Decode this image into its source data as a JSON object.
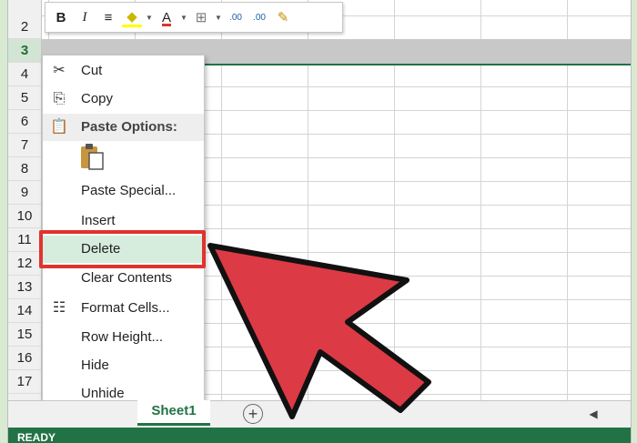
{
  "rows": [
    "2",
    "3",
    "4",
    "5",
    "6",
    "7",
    "8",
    "9",
    "10",
    "11",
    "12",
    "13",
    "14",
    "15",
    "16",
    "17"
  ],
  "selected_row": "3",
  "toolbar": {
    "bold": "B",
    "italic": "I",
    "align": "≡",
    "fill": "◆",
    "font_color": "A",
    "borders": "⊞",
    "increase_decimal": ".00",
    "decrease_decimal": ".00",
    "format_painter": "✎"
  },
  "menu": {
    "cut": "Cut",
    "copy": "Copy",
    "paste_options": "Paste Options:",
    "paste_special": "Paste Special...",
    "insert": "Insert",
    "delete": "Delete",
    "clear_contents": "Clear Contents",
    "format_cells": "Format Cells...",
    "row_height": "Row Height...",
    "hide": "Hide",
    "unhide": "Unhide"
  },
  "sheet": {
    "tab_label": "Sheet1",
    "add_sheet": "+"
  },
  "status": {
    "text": "READY"
  },
  "colors": {
    "excel_green": "#217346",
    "highlight_red": "#e0332f",
    "arrow_red": "#dc3a45"
  }
}
